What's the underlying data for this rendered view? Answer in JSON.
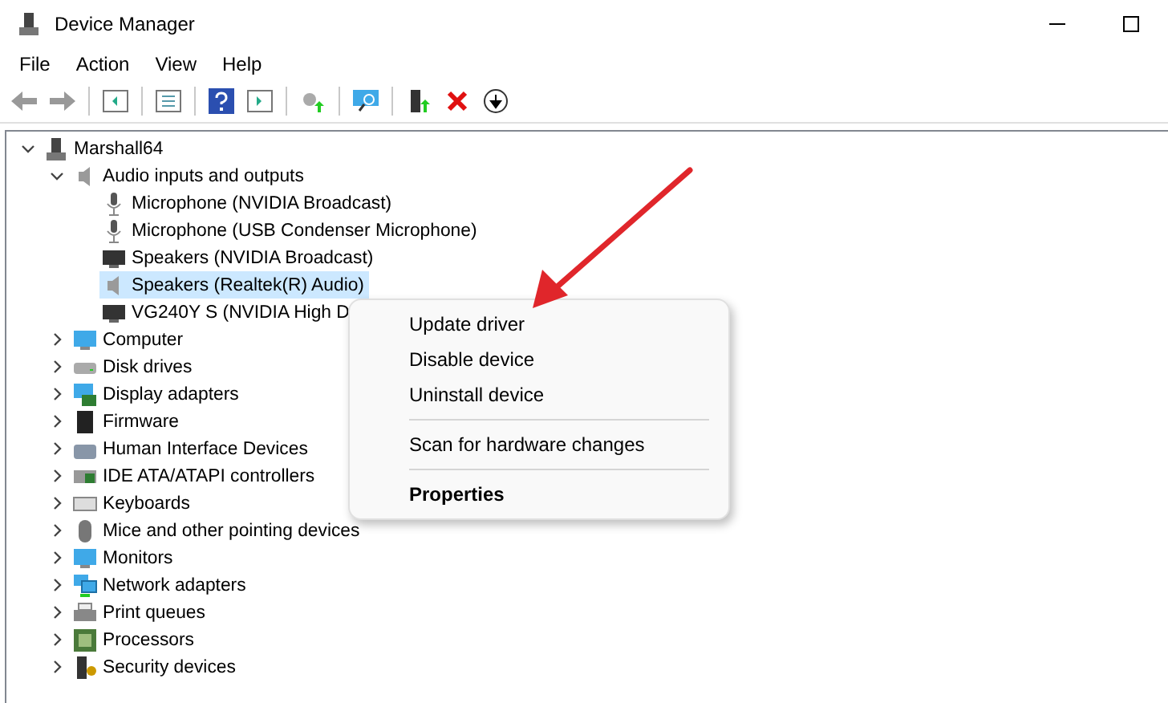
{
  "window": {
    "title": "Device Manager"
  },
  "menu": [
    "File",
    "Action",
    "View",
    "Help"
  ],
  "tree": {
    "label": "Marshall64",
    "kind": "computer",
    "expanded": true,
    "selected": false,
    "children": [
      {
        "label": "Audio inputs and outputs",
        "kind": "audio",
        "expanded": true,
        "selected": false,
        "children": [
          {
            "label": "Microphone (NVIDIA Broadcast)",
            "kind": "mic",
            "selected": false
          },
          {
            "label": "Microphone (USB Condenser Microphone)",
            "kind": "mic",
            "selected": false
          },
          {
            "label": "Speakers (NVIDIA Broadcast)",
            "kind": "screen",
            "selected": false
          },
          {
            "label": "Speakers (Realtek(R) Audio)",
            "kind": "audio",
            "selected": true
          },
          {
            "label": "VG240Y S (NVIDIA High D",
            "kind": "screen",
            "selected": false
          }
        ]
      },
      {
        "label": "Computer",
        "kind": "monitor",
        "expanded": false,
        "selected": false
      },
      {
        "label": "Disk drives",
        "kind": "disk",
        "expanded": false,
        "selected": false
      },
      {
        "label": "Display adapters",
        "kind": "display",
        "expanded": false,
        "selected": false
      },
      {
        "label": "Firmware",
        "kind": "chip",
        "expanded": false,
        "selected": false
      },
      {
        "label": "Human Interface Devices",
        "kind": "hid",
        "expanded": false,
        "selected": false
      },
      {
        "label": "IDE ATA/ATAPI controllers",
        "kind": "ide",
        "expanded": false,
        "selected": false
      },
      {
        "label": "Keyboards",
        "kind": "keyboard",
        "expanded": false,
        "selected": false
      },
      {
        "label": "Mice and other pointing devices",
        "kind": "mouse",
        "expanded": false,
        "selected": false
      },
      {
        "label": "Monitors",
        "kind": "monitor",
        "expanded": false,
        "selected": false
      },
      {
        "label": "Network adapters",
        "kind": "network",
        "expanded": false,
        "selected": false
      },
      {
        "label": "Print queues",
        "kind": "printer",
        "expanded": false,
        "selected": false
      },
      {
        "label": "Processors",
        "kind": "processor",
        "expanded": false,
        "selected": false
      },
      {
        "label": "Security devices",
        "kind": "security",
        "expanded": false,
        "selected": false
      }
    ]
  },
  "context_menu": [
    {
      "label": "Update driver",
      "kind": "item",
      "bold": false
    },
    {
      "label": "Disable device",
      "kind": "item",
      "bold": false
    },
    {
      "label": "Uninstall device",
      "kind": "item",
      "bold": false
    },
    {
      "kind": "separator"
    },
    {
      "label": "Scan for hardware changes",
      "kind": "item",
      "bold": false
    },
    {
      "kind": "separator"
    },
    {
      "label": "Properties",
      "kind": "item",
      "bold": true
    }
  ]
}
